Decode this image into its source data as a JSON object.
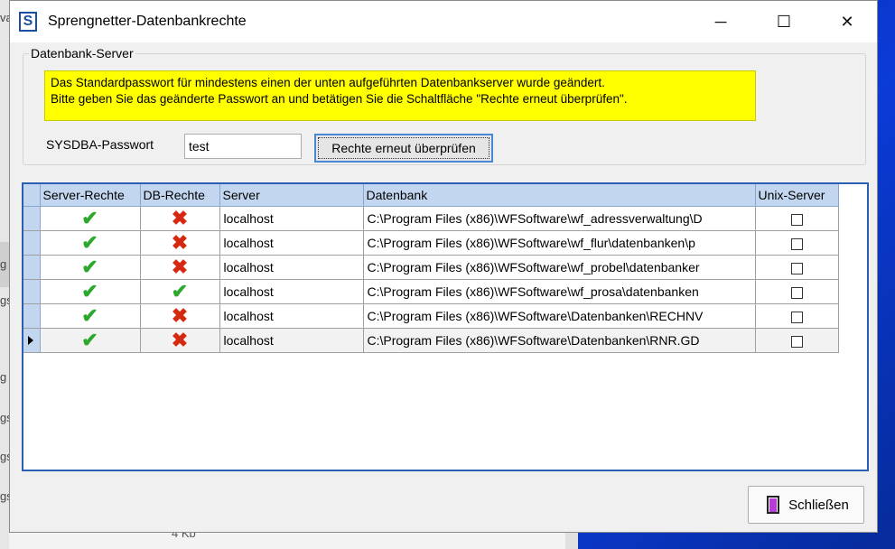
{
  "window": {
    "title": "Sprengnetter-Datenbankrechte",
    "app_icon": "S"
  },
  "titlebar": {
    "minimize": "─",
    "maximize": "☐",
    "close": "✕"
  },
  "group": {
    "legend": "Datenbank-Server"
  },
  "warning": {
    "line1": "Das Standardpasswort für mindestens einen der unten aufgeführten Datenbankserver wurde geändert.",
    "line2": "Bitte geben Sie das geänderte Passwort an und betätigen Sie die Schaltfläche \"Rechte erneut überprüfen\".",
    "color": "#ffff00"
  },
  "password": {
    "label": "SYSDBA-Passwort",
    "value": "test"
  },
  "check_button": {
    "label": "Rechte erneut überprüfen"
  },
  "table": {
    "columns": [
      "Server-Rechte",
      "DB-Rechte",
      "Server",
      "Datenbank",
      "Unix-Server"
    ],
    "rows": [
      {
        "server_rights": "ok",
        "db_rights": "no",
        "server": "localhost",
        "database": "C:\\Program Files (x86)\\WFSoftware\\wf_adressverwaltung\\D",
        "unix": false
      },
      {
        "server_rights": "ok",
        "db_rights": "no",
        "server": "localhost",
        "database": "C:\\Program Files (x86)\\WFSoftware\\wf_flur\\datenbanken\\p",
        "unix": false
      },
      {
        "server_rights": "ok",
        "db_rights": "no",
        "server": "localhost",
        "database": "C:\\Program Files (x86)\\WFSoftware\\wf_probel\\datenbanker",
        "unix": false
      },
      {
        "server_rights": "ok",
        "db_rights": "ok",
        "server": "localhost",
        "database": "C:\\Program Files (x86)\\WFSoftware\\wf_prosa\\datenbanken",
        "unix": false
      },
      {
        "server_rights": "ok",
        "db_rights": "no",
        "server": "localhost",
        "database": "C:\\Program Files (x86)\\WFSoftware\\Datenbanken\\RECHNV",
        "unix": false
      },
      {
        "server_rights": "ok",
        "db_rights": "no",
        "server": "localhost",
        "database": "C:\\Program Files (x86)\\WFSoftware\\Datenbanken\\RNR.GD",
        "unix": false,
        "current": true
      }
    ]
  },
  "close_button": {
    "label": "Schließen"
  },
  "background": {
    "fragments": [
      "va",
      "g",
      "gs",
      "g",
      "gs",
      "gs",
      "gs"
    ],
    "size_text": "4 Kb"
  }
}
